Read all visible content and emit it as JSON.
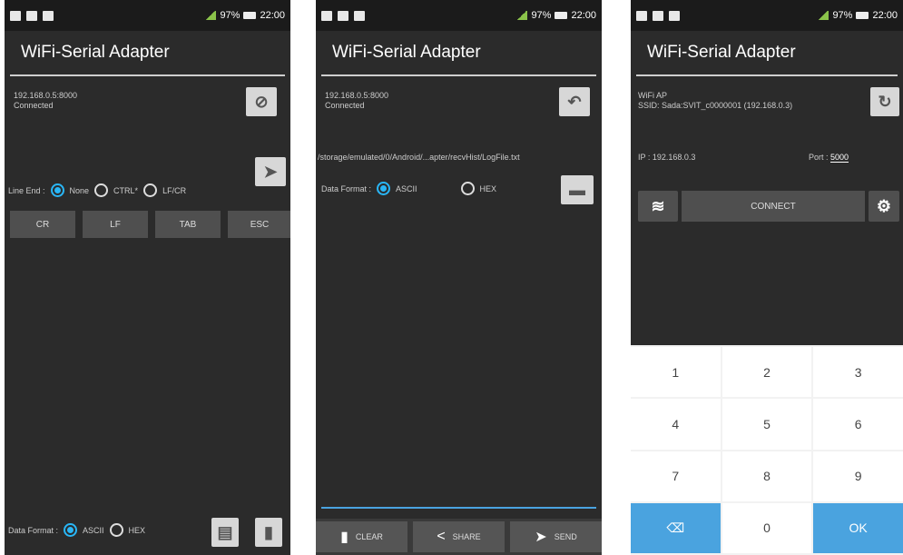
{
  "status_bar": {
    "signal": "97%",
    "time": "22:00"
  },
  "app_title": "WiFi-Serial Adapter",
  "screen1": {
    "address": "192.168.0.5:8000",
    "state": "Connected",
    "line_end_label": "Line End :",
    "line_end_options": [
      "None",
      "CTRL*",
      "LF/CR"
    ],
    "line_end_selected": "None",
    "keys": [
      "CR",
      "LF",
      "TAB",
      "ESC"
    ],
    "data_format_label": "Data Format :",
    "format_options": [
      "ASCII",
      "HEX"
    ],
    "format_selected": "ASCII"
  },
  "screen2": {
    "address": "192.168.0.5:8000",
    "state": "Connected",
    "log_path": "/storage/emulated/0/Android/...apter/recvHist/LogFile.txt",
    "data_format_label": "Data Format :",
    "format_options": [
      "ASCII",
      "HEX"
    ],
    "format_selected": "ASCII",
    "bottom_buttons": [
      "CLEAR",
      "SHARE",
      "SEND"
    ]
  },
  "screen3": {
    "wifi_label": "WiFi AP",
    "ssid_text": "SSID: Sada:SVIT_c0000001 (192.168.0.3)",
    "ip_label": "IP :",
    "ip_value": "192.168.0.3",
    "port_label": "Port :",
    "port_value": "5000",
    "connect_label": "CONNECT",
    "numpad_keys": [
      "1",
      "2",
      "3",
      "4",
      "5",
      "6",
      "7",
      "8",
      "9",
      "⌫",
      "0",
      "OK"
    ]
  },
  "colors": {
    "accent": "#29b6f6",
    "background": "#2b2b2b",
    "numpad_action": "#4aa3df"
  }
}
